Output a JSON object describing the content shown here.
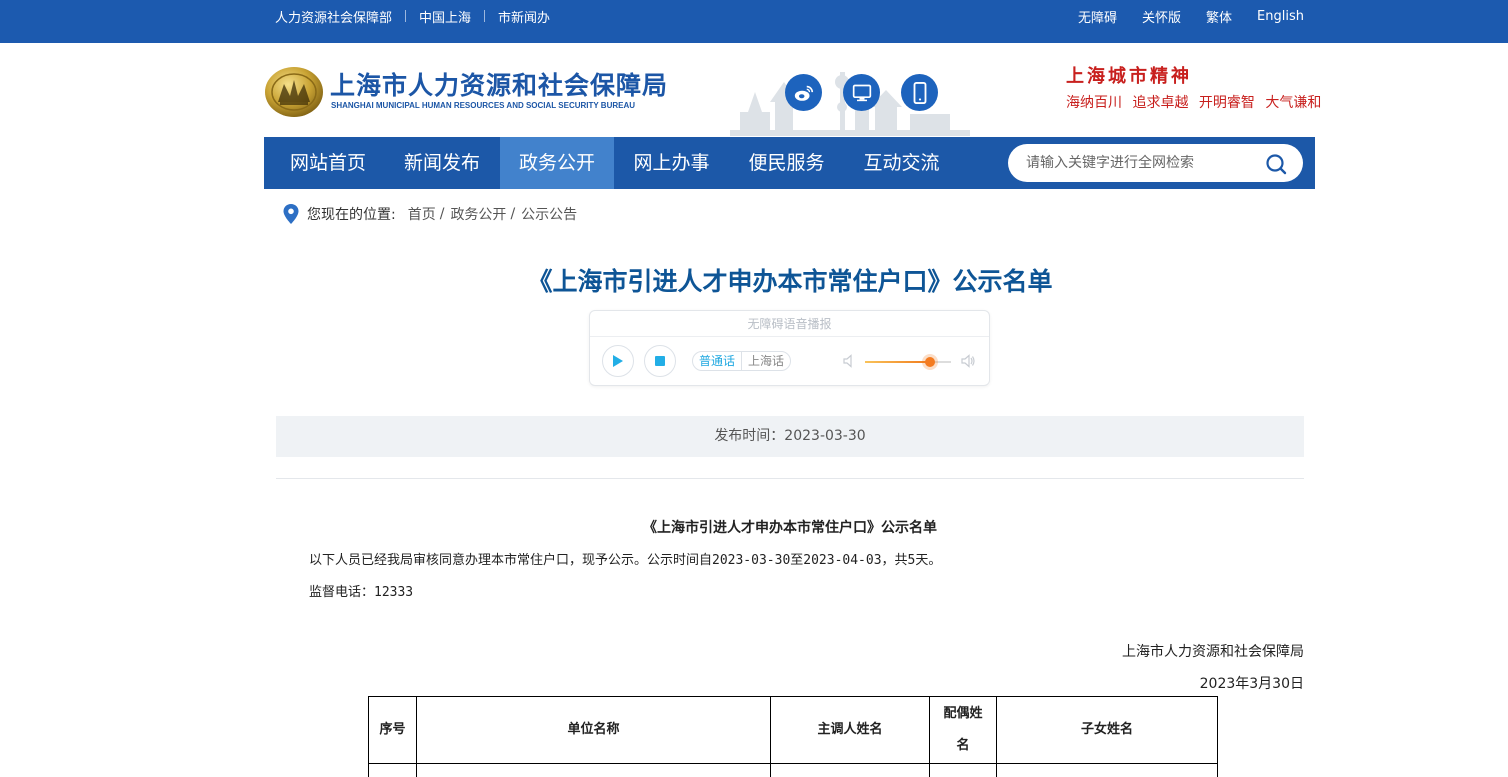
{
  "topbar": {
    "links": [
      "人力资源社会保障部",
      "中国上海",
      "市新闻办"
    ],
    "right": [
      "无障碍",
      "关怀版",
      "繁体",
      "English"
    ]
  },
  "header": {
    "title": "上海市人力资源和社会保障局",
    "subtitle": "SHANGHAI MUNICIPAL HUMAN RESOURCES AND SOCIAL SECURITY BUREAU",
    "slogan_title": "上海城市精神",
    "slogan_items": [
      "海纳百川",
      "追求卓越",
      "开明睿智",
      "大气谦和"
    ]
  },
  "nav": {
    "items": [
      "网站首页",
      "新闻发布",
      "政务公开",
      "网上办事",
      "便民服务",
      "互动交流"
    ],
    "active_index": 2,
    "search_placeholder": "请输入关键字进行全网检索"
  },
  "breadcrumb": {
    "label": "您现在的位置:",
    "items": [
      "首页",
      "政务公开",
      "公示公告"
    ]
  },
  "article": {
    "title": "《上海市引进人才申办本市常住户口》公示名单",
    "publish": "发布时间：2023-03-30",
    "doc_title": "《上海市引进人才申办本市常住户口》公示名单",
    "para1": "以下人员已经我局审核同意办理本市常住户口，现予公示。公示时间自2023-03-30至2023-04-03，共5天。",
    "para2": "监督电话：12333",
    "sign_org": "上海市人力资源和社会保障局",
    "sign_date": "2023年3月30日"
  },
  "audio": {
    "header": "无障碍语音播报",
    "lang_on": "普通话",
    "lang_off": "上海话",
    "volume": 0.75
  },
  "table": {
    "headers": [
      "序号",
      "单位名称",
      "主调人姓名",
      "配偶姓名",
      "子女姓名"
    ]
  },
  "colors": {
    "brand_blue": "#1c5aaf",
    "nav_active": "#4282cc",
    "title_blue": "#0e5596",
    "slogan_red": "#c8201e"
  }
}
